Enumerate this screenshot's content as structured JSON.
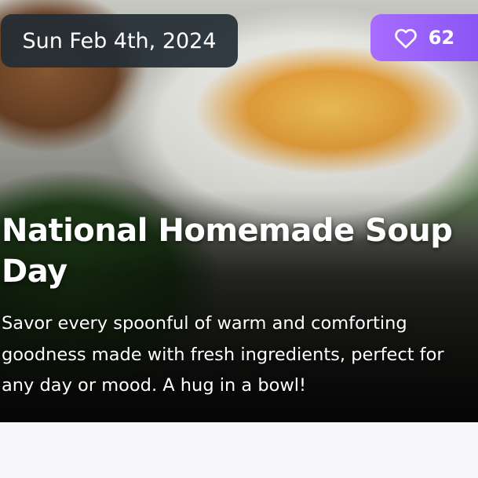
{
  "event": {
    "date": "Sun Feb 4th, 2024",
    "likes": "62",
    "title": "National Homemade Soup Day",
    "description": "Savor every spoonful of warm and comforting goodness made with fresh ingredients, perfect for any day or mood. A hug in a bowl!"
  },
  "icons": {
    "like": "heart-outline-icon"
  },
  "colors": {
    "date_pill_bg": "#232c34",
    "likes_pill_start": "#a86dff",
    "likes_pill_end": "#8a55f4",
    "text": "#ffffff",
    "page_bg": "#f7f6fa"
  }
}
